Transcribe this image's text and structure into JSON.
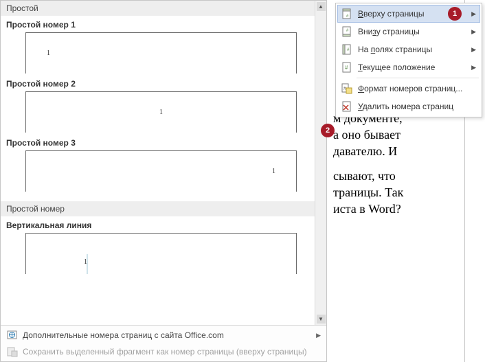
{
  "menu": {
    "items": [
      {
        "label_pre": "",
        "label_ul": "В",
        "label_post": "верху страницы",
        "has_sub": true,
        "active": true,
        "icon": "page-top"
      },
      {
        "label_pre": "Вни",
        "label_ul": "з",
        "label_post": "у страницы",
        "has_sub": true,
        "active": false,
        "icon": "page-bottom"
      },
      {
        "label_pre": "На ",
        "label_ul": "п",
        "label_post": "олях страницы",
        "has_sub": true,
        "active": false,
        "icon": "page-margin"
      },
      {
        "label_pre": "",
        "label_ul": "Т",
        "label_post": "екущее положение",
        "has_sub": true,
        "active": false,
        "icon": "page-current"
      }
    ],
    "format_label_pre": "",
    "format_label_ul": "Ф",
    "format_label_post": "ормат номеров страниц...",
    "remove_label_pre": "",
    "remove_label_ul": "У",
    "remove_label_post": "далить номера страниц"
  },
  "gallery": {
    "section1": "Простой",
    "opt1": {
      "title": "Простой номер 1",
      "num": "1"
    },
    "opt2": {
      "title": "Простой номер 2",
      "num": "1"
    },
    "opt3": {
      "title": "Простой номер 3",
      "num": "1"
    },
    "section2": "Простой номер",
    "opt4": {
      "title": "Вертикальная линия",
      "num": "1"
    },
    "footer_more": "Дополнительные номера страниц с сайта Office.com",
    "footer_save": "Сохранить выделенный фрагмент как номер страницы (вверху страницы)"
  },
  "bg": {
    "p1a": "м документе,",
    "p1b": "а оно бывает",
    "p1c": "давателю. И",
    "p2a": "сывают, что",
    "p2b": "траницы. Так",
    "p2c": "иста в Word?"
  },
  "badges": {
    "b1": "1",
    "b2": "2"
  }
}
